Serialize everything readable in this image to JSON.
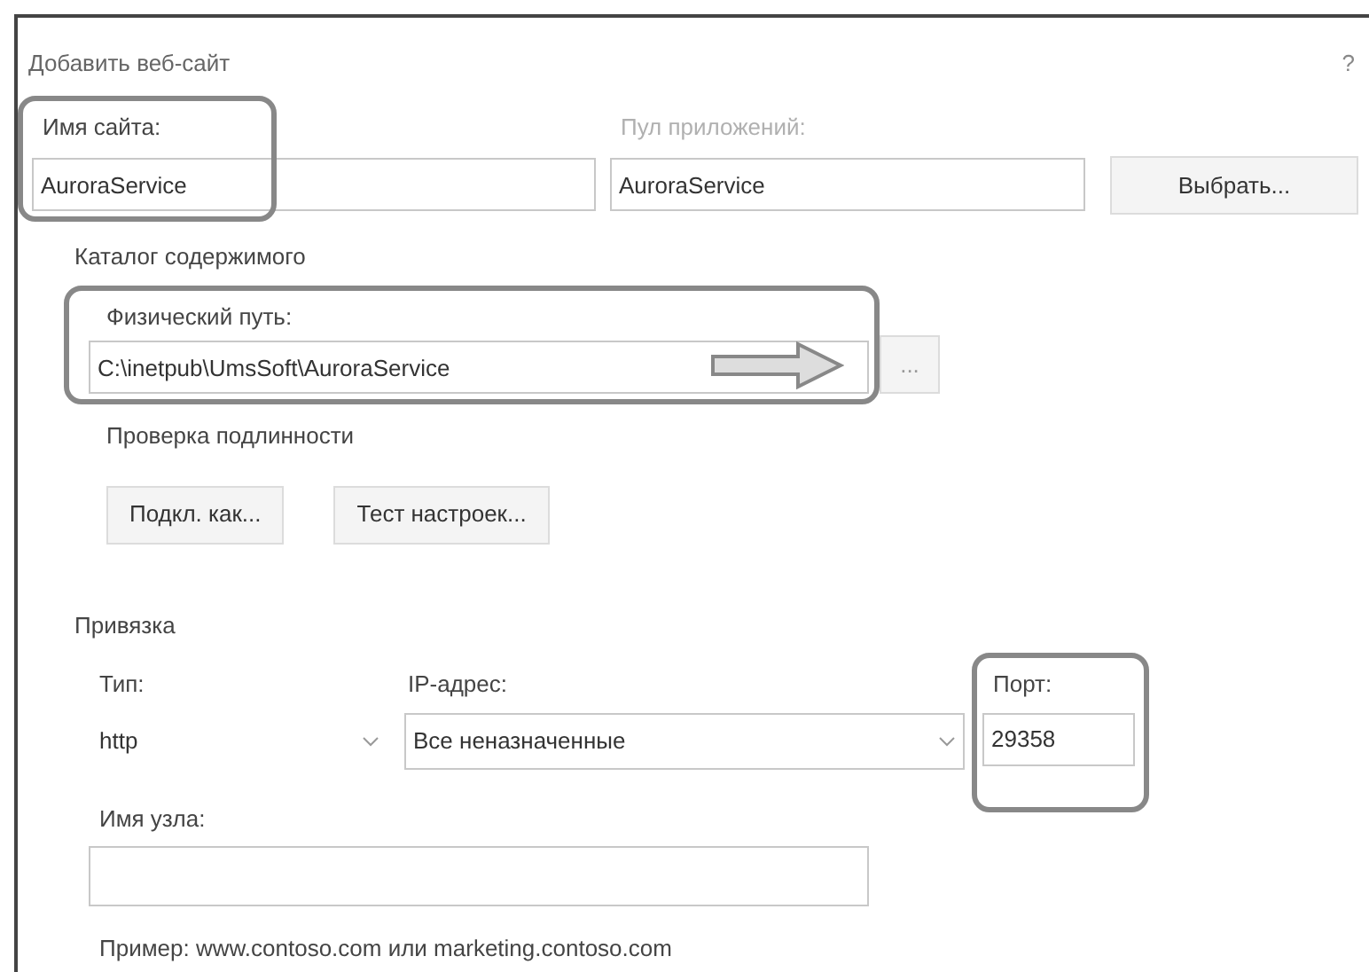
{
  "window": {
    "title": "Добавить веб-сайт",
    "help": "?"
  },
  "site_name": {
    "label": "Имя сайта:",
    "value": "AuroraService"
  },
  "app_pool": {
    "label": "Пул приложений:",
    "value": "AuroraService",
    "button": "Выбрать..."
  },
  "content_directory": {
    "title": "Каталог содержимого",
    "physical_path": {
      "label": "Физический путь:",
      "value": "C:\\inetpub\\UmsSoft\\AuroraService",
      "browse_button": "..."
    },
    "auth_title": "Проверка подлинности",
    "buttons": [
      "Подкл. как...",
      "Тест настроек..."
    ]
  },
  "binding": {
    "title": "Привязка",
    "type": {
      "label": "Тип:",
      "value": "http"
    },
    "ip": {
      "label": "IP-адрес:",
      "value": "Все неназначенные"
    },
    "port": {
      "label": "Порт:",
      "value": "29358"
    },
    "host": {
      "label": "Имя узла:"
    },
    "example": "Пример: www.contoso.com или marketing.contoso.com"
  }
}
